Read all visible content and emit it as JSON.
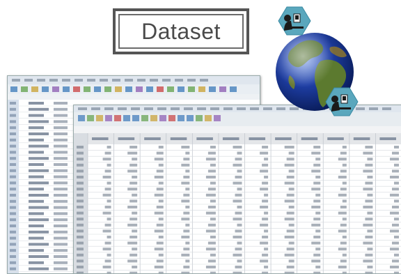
{
  "title": {
    "text": "Dataset"
  },
  "back_sheet": {
    "rows": 28
  },
  "front_sheet": {
    "columns": 12,
    "rows": 23
  },
  "colors": {
    "accent_blue": "#3a78b8",
    "grid_line": "#c9ccd1",
    "badge": "#5aa7bd"
  },
  "icons": [
    "researcher-computer-icon",
    "globe-icon"
  ]
}
